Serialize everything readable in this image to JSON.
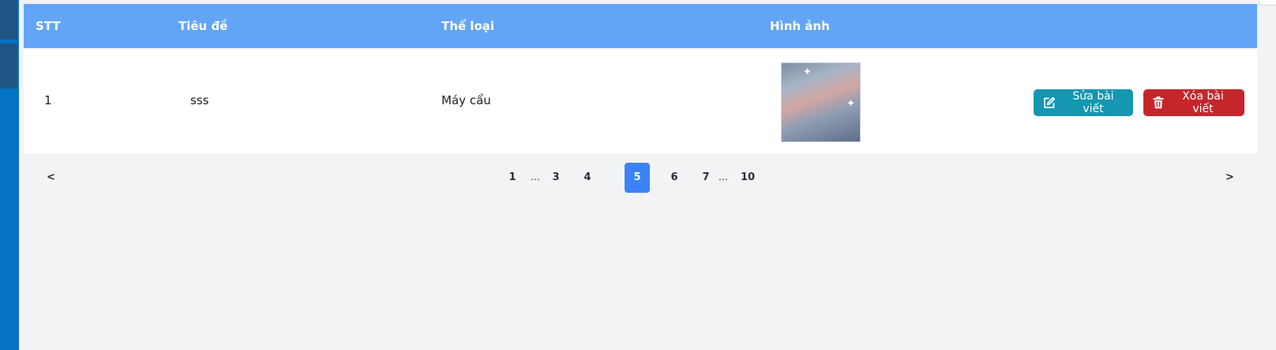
{
  "table": {
    "headers": {
      "stt": "STT",
      "title": "Tiêu đề",
      "category": "Thể loại",
      "image": "Hình ảnh"
    },
    "rows": [
      {
        "stt": "1",
        "title": "sss",
        "category": "Máy cẩu",
        "image_alt": "cloudy-sky-thumbnail",
        "edit_label": "Sửa bài viết",
        "delete_label": "Xóa bài viết"
      }
    ]
  },
  "pagination": {
    "prev": "<",
    "next": ">",
    "pages": [
      "1",
      "...",
      "3",
      "4",
      "5",
      "6",
      "7",
      "...",
      "10"
    ],
    "current": "5"
  },
  "colors": {
    "header_bg": "#62a5f6",
    "edit_button": "#1596b1",
    "delete_button": "#c5262c",
    "active_page": "#3b82f6",
    "sidebar": "#0672c4"
  },
  "icons": {
    "edit": "pencil-square-icon",
    "delete": "trash-icon"
  }
}
